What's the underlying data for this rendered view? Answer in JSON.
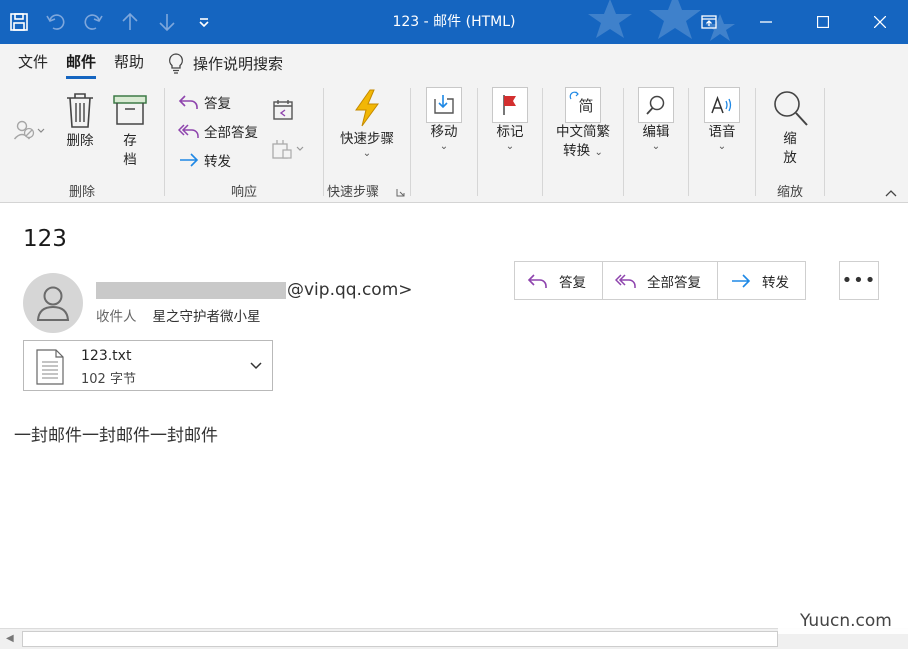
{
  "window": {
    "title": "123  -  邮件 (HTML)"
  },
  "ribbon_tabs": {
    "file": "文件",
    "mail": "邮件",
    "help": "帮助",
    "tell_me": "操作说明搜索"
  },
  "ribbon": {
    "delete_group": {
      "delete_label": "删除",
      "archive_label_1": "存",
      "archive_label_2": "档",
      "group_label": "删除"
    },
    "respond_group": {
      "reply": "答复",
      "reply_all": "全部答复",
      "forward": "转发",
      "group_label": "响应"
    },
    "quicksteps_group": {
      "button_label": "快速步骤",
      "group_label": "快速步骤"
    },
    "move_label": "移动",
    "tags_label": "标记",
    "chinese_convert_1": "中文简繁",
    "chinese_convert_2": "转换",
    "chinese_convert_icon_text": "简",
    "editing_label": "编辑",
    "speech_label": "语音",
    "zoom_group": {
      "zoom_label_1": "缩",
      "zoom_label_2": "放",
      "group_label": "缩放"
    }
  },
  "message": {
    "subject": "123",
    "sender_domain": "@vip.qq.com>",
    "to_label": "收件人",
    "to_name": "星之守护者微小星",
    "actions": {
      "reply": "答复",
      "reply_all": "全部答复",
      "forward": "转发",
      "more": "•••"
    },
    "attachment": {
      "name": "123.txt",
      "size": "102 字节"
    },
    "body": "一封邮件一封邮件一封邮件"
  },
  "watermark": "Yuucn.com",
  "colors": {
    "titlebar": "#1565c0",
    "reply_purple": "#8e44ad",
    "forward_blue": "#1e88e5",
    "flag_red": "#d32f2f",
    "lightning": "#f2b705"
  }
}
